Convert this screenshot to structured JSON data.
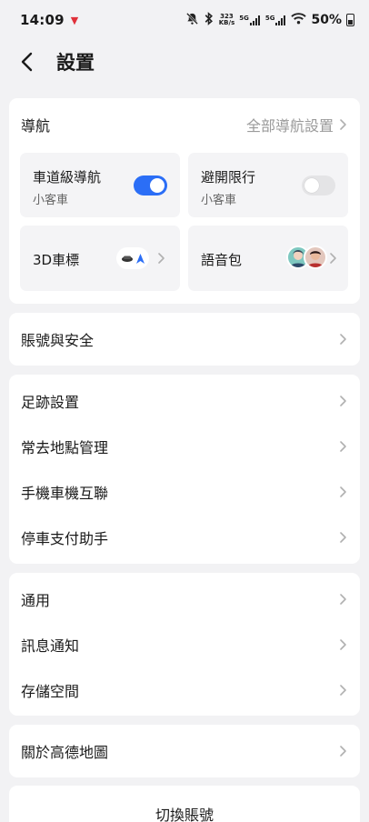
{
  "status_bar": {
    "time": "14:09",
    "net_speed_value": "323",
    "net_speed_unit": "KB/s",
    "sim1": "5G",
    "sim2": "5G",
    "battery": "50%"
  },
  "header": {
    "title": "設置"
  },
  "navigation": {
    "title": "導航",
    "all_settings": "全部導航設置",
    "tiles": {
      "lane": {
        "title": "車道級導航",
        "sub": "小客車",
        "enabled": true
      },
      "restriction": {
        "title": "避開限行",
        "sub": "小客車",
        "enabled": false
      },
      "car_icon": {
        "title": "3D車標"
      },
      "voice": {
        "title": "語音包"
      }
    }
  },
  "account_security": "賬號與安全",
  "group1": [
    "足跡設置",
    "常去地點管理",
    "手機車機互聯",
    "停車支付助手"
  ],
  "group2": [
    "通用",
    "訊息通知",
    "存儲空間"
  ],
  "about": "關於高德地圖",
  "switch_account": "切換賬號",
  "colors": {
    "accent": "#2b6ef6",
    "background": "#f2f2f4",
    "card": "#ffffff",
    "tile": "#f4f4f6"
  }
}
